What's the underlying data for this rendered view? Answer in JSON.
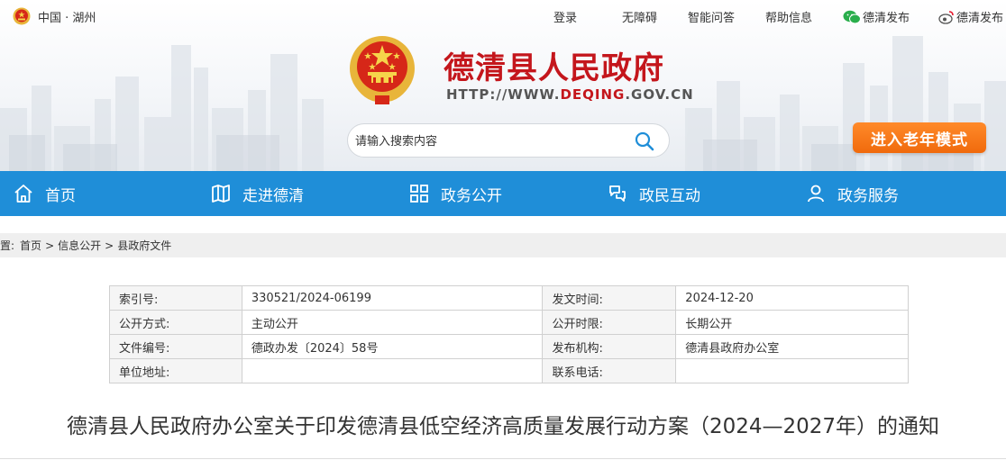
{
  "topbar": {
    "location": "中国 · 湖州",
    "links": [
      "登录",
      "无障碍",
      "智能问答",
      "帮助信息"
    ],
    "wechat": "德清发布",
    "weibo": "德清发布"
  },
  "site": {
    "title": "德清县人民政府",
    "url_prefix": "HTTP://WWW.",
    "url_domain": "DEQING",
    "url_suffix": ".GOV.CN"
  },
  "search": {
    "placeholder": "请输入搜索内容"
  },
  "elder_mode": "进入老年模式",
  "nav": [
    {
      "label": "首页",
      "icon": "home-icon"
    },
    {
      "label": "走进德清",
      "icon": "map-icon"
    },
    {
      "label": "政务公开",
      "icon": "grid-icon"
    },
    {
      "label": "政民互动",
      "icon": "interaction-icon"
    },
    {
      "label": "政务服务",
      "icon": "user-icon"
    }
  ],
  "breadcrumb": {
    "prefix": "置:",
    "items": [
      "首页",
      "信息公开",
      "县政府文件"
    ],
    "separator": ">"
  },
  "info_table": [
    {
      "k1": "索引号:",
      "v1": "330521/2024-06199",
      "k2": "发文时间:",
      "v2": "2024-12-20"
    },
    {
      "k1": "公开方式:",
      "v1": "主动公开",
      "k2": "公开时限:",
      "v2": "长期公开"
    },
    {
      "k1": "文件编号:",
      "v1": "德政办发〔2024〕58号",
      "k2": "发布机构:",
      "v2": "德清县政府办公室"
    },
    {
      "k1": "单位地址:",
      "v1": "",
      "k2": "联系电话:",
      "v2": ""
    }
  ],
  "document_title": "德清县人民政府办公室关于印发德清县低空经济高质量发展行动方案（2024—2027年）的通知",
  "colors": {
    "brand_red": "#c4161c",
    "nav_blue": "#1f8ed8",
    "elder_orange": "#f06a0c"
  }
}
